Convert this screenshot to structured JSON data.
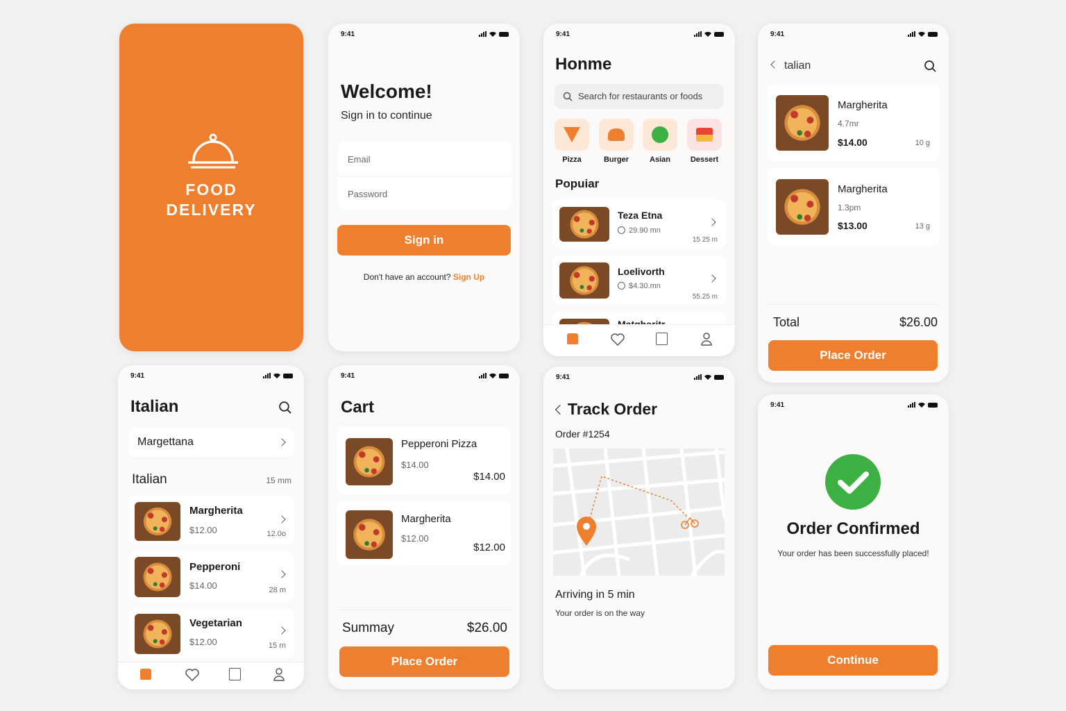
{
  "status_time": "9:41",
  "splash": {
    "line1": "FOOD",
    "line2": "DELIVERY"
  },
  "login": {
    "title": "Welcome!",
    "subtitle": "Sign in to continue",
    "email_placeholder": "Email",
    "password_placeholder": "Password",
    "signin_label": "Sign in",
    "no_account": "Don't have an account?",
    "signup_label": "Sign Up"
  },
  "home": {
    "title": "Honme",
    "search_placeholder": "Search for restaurants or foods",
    "categories": [
      {
        "label": "Pizza",
        "icon": "pizza-icon"
      },
      {
        "label": "Burger",
        "icon": "burger-icon"
      },
      {
        "label": "Asian",
        "icon": "asian-icon"
      },
      {
        "label": "Dessert",
        "icon": "dessert-icon"
      }
    ],
    "popular_title": "Popuiar",
    "items": [
      {
        "name": "Teza Etna",
        "meta": "29.90 mn",
        "extra": "15 25 m"
      },
      {
        "name": "Loelivorth",
        "meta": "$4.30.mn",
        "extra": "55.25 m"
      },
      {
        "name": "Matgharitr"
      }
    ]
  },
  "italian_detail": {
    "title": "talian",
    "items": [
      {
        "name": "Margherita",
        "meta": "4.7mr",
        "price": "$14.00",
        "weight": "10 g"
      },
      {
        "name": "Margherita",
        "meta": "1.3pm",
        "price": "$13.00",
        "weight": "13 g"
      }
    ],
    "total_label": "Total",
    "total_value": "$26.00",
    "place_order": "Place Order"
  },
  "italian_list": {
    "title": "Italian",
    "filter": "Margettana",
    "section": "Italian",
    "section_meta": "15 mm",
    "items": [
      {
        "name": "Margherita",
        "price": "$12.00",
        "extra": "12.0o"
      },
      {
        "name": "Pepperoni",
        "price": "$14.00",
        "extra": "28 m"
      },
      {
        "name": "Vegetarian",
        "price": "$12.00",
        "extra": "15 rn"
      }
    ]
  },
  "cart": {
    "title": "Cart",
    "items": [
      {
        "name": "Pepperoni Pizza",
        "unit": "$14.00",
        "total": "$14.00"
      },
      {
        "name": "Margherita",
        "unit": "$12.00",
        "total": "$12.00"
      }
    ],
    "summary_label": "Summay",
    "summary_value": "$26.00",
    "place_order": "Place Order"
  },
  "track": {
    "title": "Track Order",
    "order_no": "Order #1254",
    "arriving": "Arriving in 5 min",
    "sub": "Your order is on the way"
  },
  "confirm": {
    "title": "Order Confirmed",
    "sub": "Your order has been successfully placed!",
    "continue_label": "Continue"
  },
  "colors": {
    "accent": "#ee7f2f",
    "success": "#3cb043"
  }
}
